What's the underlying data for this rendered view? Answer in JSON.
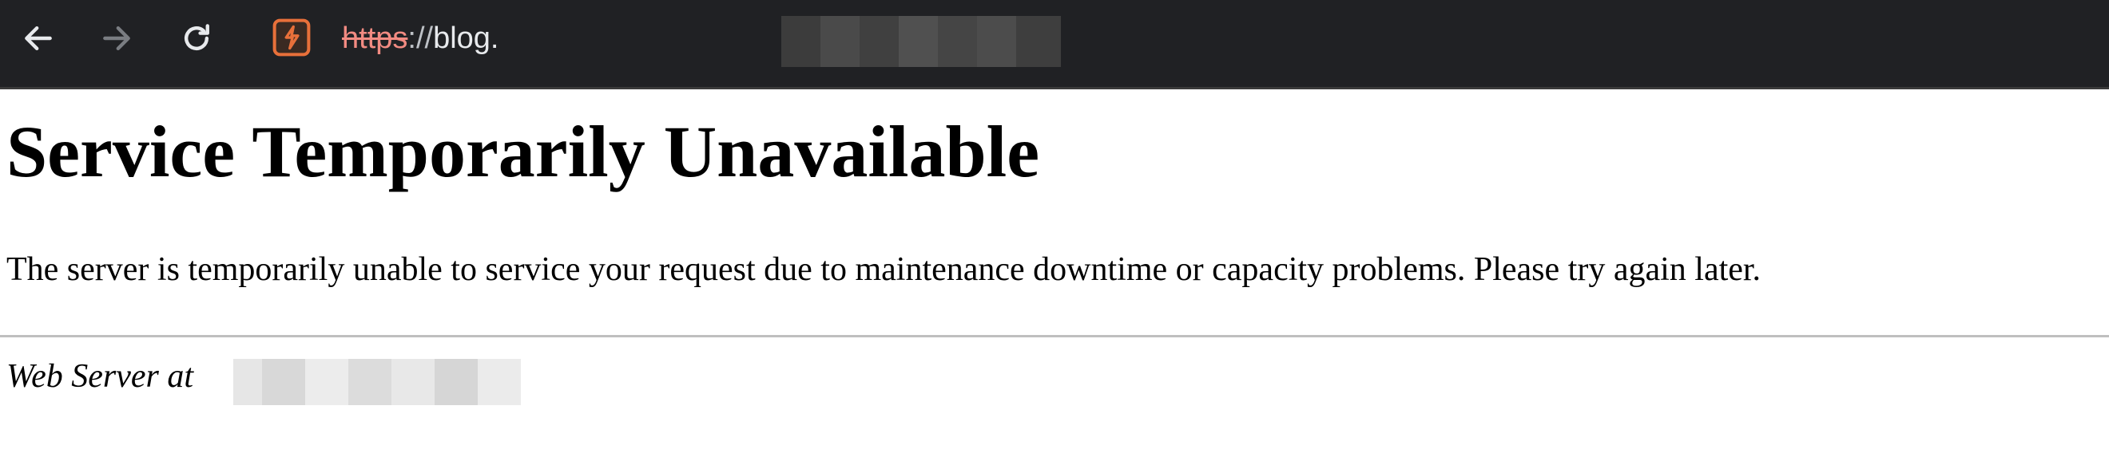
{
  "browser": {
    "url": {
      "scheme": "https",
      "separator": "://",
      "host_visible": "blog."
    },
    "icons": {
      "back": "arrow-left-icon",
      "forward": "arrow-right-icon",
      "reload": "reload-icon",
      "site": "insecure-site-icon"
    },
    "colors": {
      "toolbar_bg": "#202124",
      "insecure_scheme": "#f28b82",
      "site_icon": "#e8703a"
    }
  },
  "page": {
    "heading": "Service Temporarily Unavailable",
    "message": "The server is temporarily unable to service your request due to maintenance downtime or capacity problems. Please try again later.",
    "footer_prefix": "Web Server at"
  }
}
